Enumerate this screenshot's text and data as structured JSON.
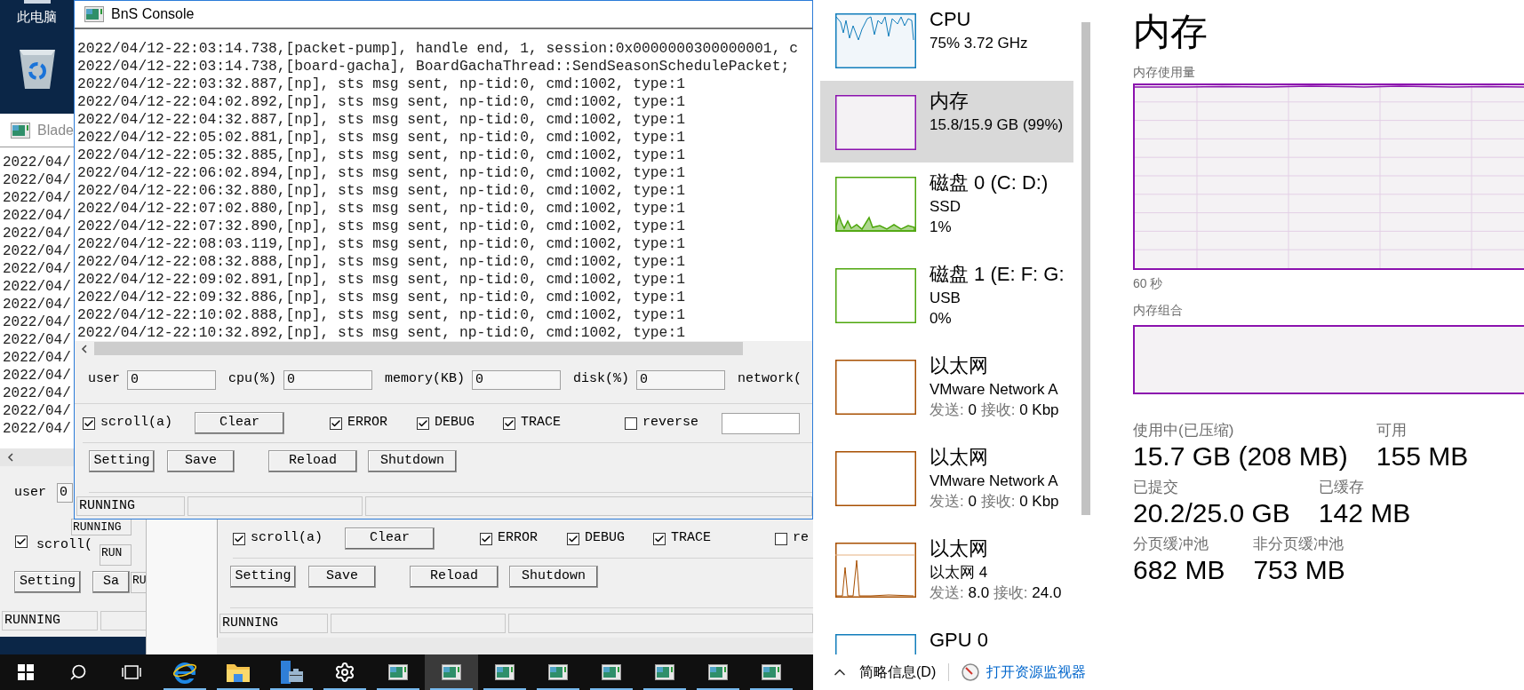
{
  "desktop_icons": [
    {
      "kind": "computer",
      "label": "此电脑"
    },
    {
      "kind": "recycle_bin"
    }
  ],
  "back_window": {
    "title": "Blade",
    "log_lines": [
      "2022/04/",
      "2022/04/",
      "2022/04/",
      "2022/04/",
      "2022/04/",
      "2022/04/",
      "2022/04/",
      "2022/04/",
      "2022/04/",
      "2022/04/",
      "2022/04/",
      "2022/04/",
      "2022/04/",
      "2022/04/",
      "2022/04/",
      "2022/04/"
    ],
    "field": {
      "label": "user",
      "value": "0"
    },
    "checkbox": {
      "label": "scroll(",
      "checked": true
    },
    "buttons": [
      "Setting",
      "Sa"
    ],
    "status": "RUNNING"
  },
  "stacked_status": [
    "RUNNING",
    "RUN",
    "RU"
  ],
  "console": {
    "title": "BnS Console",
    "log_lines": [
      "2022/04/12-22:03:14.738,[packet-pump], handle end, 1, session:0x0000000300000001, c",
      "2022/04/12-22:03:14.738,[board-gacha], BoardGachaThread::SendSeasonSchedulePacket;",
      "2022/04/12-22:03:32.887,[np], sts msg sent, np-tid:0, cmd:1002, type:1",
      "2022/04/12-22:04:02.892,[np], sts msg sent, np-tid:0, cmd:1002, type:1",
      "2022/04/12-22:04:32.887,[np], sts msg sent, np-tid:0, cmd:1002, type:1",
      "2022/04/12-22:05:02.881,[np], sts msg sent, np-tid:0, cmd:1002, type:1",
      "2022/04/12-22:05:32.885,[np], sts msg sent, np-tid:0, cmd:1002, type:1",
      "2022/04/12-22:06:02.894,[np], sts msg sent, np-tid:0, cmd:1002, type:1",
      "2022/04/12-22:06:32.880,[np], sts msg sent, np-tid:0, cmd:1002, type:1",
      "2022/04/12-22:07:02.880,[np], sts msg sent, np-tid:0, cmd:1002, type:1",
      "2022/04/12-22:07:32.890,[np], sts msg sent, np-tid:0, cmd:1002, type:1",
      "2022/04/12-22:08:03.119,[np], sts msg sent, np-tid:0, cmd:1002, type:1",
      "2022/04/12-22:08:32.888,[np], sts msg sent, np-tid:0, cmd:1002, type:1",
      "2022/04/12-22:09:02.891,[np], sts msg sent, np-tid:0, cmd:1002, type:1",
      "2022/04/12-22:09:32.886,[np], sts msg sent, np-tid:0, cmd:1002, type:1",
      "2022/04/12-22:10:02.888,[np], sts msg sent, np-tid:0, cmd:1002, type:1",
      "2022/04/12-22:10:32.892,[np], sts msg sent, np-tid:0, cmd:1002, type:1"
    ],
    "fields": [
      {
        "label": "user",
        "value": "0"
      },
      {
        "label": "cpu(%)",
        "value": "0"
      },
      {
        "label": "memory(KB)",
        "value": "0"
      },
      {
        "label": "disk(%)",
        "value": "0"
      },
      {
        "label": "network("
      }
    ],
    "toolbar": [
      {
        "kind": "checkbox",
        "label": "scroll(a)",
        "checked": true
      },
      {
        "kind": "button",
        "label": "Clear"
      },
      {
        "kind": "checkbox",
        "label": "ERROR",
        "checked": true
      },
      {
        "kind": "checkbox",
        "label": "DEBUG",
        "checked": true
      },
      {
        "kind": "checkbox",
        "label": "TRACE",
        "checked": true
      },
      {
        "kind": "checkbox",
        "label": "reverse",
        "checked": false
      },
      {
        "kind": "field"
      }
    ],
    "buttons": [
      "Setting",
      "Save",
      "Reload",
      "Shutdown"
    ],
    "status": "RUNNING"
  },
  "lower_console": {
    "toolbar": [
      {
        "kind": "checkbox",
        "label": "scroll(a)",
        "checked": true
      },
      {
        "kind": "button",
        "label": "Clear"
      },
      {
        "kind": "checkbox",
        "label": "ERROR",
        "checked": true
      },
      {
        "kind": "checkbox",
        "label": "DEBUG",
        "checked": true
      },
      {
        "kind": "checkbox",
        "label": "TRACE",
        "checked": true
      },
      {
        "kind": "checkbox",
        "label": "re",
        "checked": false
      }
    ],
    "buttons": [
      "Setting",
      "Save",
      "Reload",
      "Shutdown"
    ],
    "status": "RUNNING"
  },
  "taskbar": [
    {
      "kind": "start",
      "selected": false,
      "running": false
    },
    {
      "kind": "search",
      "selected": false,
      "running": false
    },
    {
      "kind": "task_view",
      "selected": false,
      "running": false
    },
    {
      "kind": "browser",
      "selected": false,
      "running": true
    },
    {
      "kind": "folder",
      "selected": false,
      "running": true
    },
    {
      "kind": "server_manager",
      "selected": false,
      "running": true
    },
    {
      "kind": "settings",
      "selected": false,
      "running": true
    },
    {
      "kind": "console",
      "selected": false,
      "running": true
    },
    {
      "kind": "console",
      "selected": true,
      "running": true
    },
    {
      "kind": "console",
      "selected": false,
      "running": true
    },
    {
      "kind": "console",
      "selected": false,
      "running": true
    },
    {
      "kind": "console",
      "selected": false,
      "running": true
    },
    {
      "kind": "console",
      "selected": false,
      "running": true
    },
    {
      "kind": "console",
      "selected": false,
      "running": true
    },
    {
      "kind": "console",
      "selected": false,
      "running": true
    }
  ],
  "task_manager": {
    "sidebar": [
      {
        "kind": "cpu",
        "title": "CPU",
        "selected": false,
        "active": true,
        "lines": [
          "75%  3.72 GHz"
        ]
      },
      {
        "kind": "memory",
        "title": "内存",
        "selected": true,
        "lines": [
          "15.8/15.9 GB (99%)"
        ]
      },
      {
        "kind": "disk",
        "title": "磁盘 0 (C: D:)",
        "selected": false,
        "active": true,
        "lines": [
          "SSD",
          "1%"
        ]
      },
      {
        "kind": "disk",
        "title": "磁盘 1 (E: F: G:",
        "selected": false,
        "active": false,
        "lines": [
          "USB",
          "0%"
        ]
      },
      {
        "kind": "ethernet",
        "title": "以太网",
        "selected": false,
        "active": false,
        "lines": [
          "VMware Network A"
        ],
        "traffic": {
          "sent_label": "发送:",
          "sent": "0",
          "recv_label": "接收:",
          "recv": "0 Kbp"
        }
      },
      {
        "kind": "ethernet",
        "title": "以太网",
        "selected": false,
        "active": false,
        "lines": [
          "VMware Network A"
        ],
        "traffic": {
          "sent_label": "发送:",
          "sent": "0",
          "recv_label": "接收:",
          "recv": "0 Kbp"
        }
      },
      {
        "kind": "ethernet",
        "title": "以太网",
        "selected": false,
        "active": true,
        "lines": [
          "以太网 4"
        ],
        "traffic": {
          "sent_label": "发送:",
          "sent": "8.0",
          "recv_label": "接收:",
          "recv": "24.0"
        }
      },
      {
        "kind": "gpu",
        "title": "GPU 0",
        "selected": false
      }
    ],
    "footer": {
      "toggle": "简略信息(D)",
      "link": "打开资源监视器"
    },
    "detail": {
      "title": "内存",
      "usage_label": "内存使用量",
      "time_label": "60 秒",
      "composition_label": "内存组合",
      "stats": [
        [
          {
            "label": "使用中(已压缩)",
            "value": "15.7 GB (208 MB)"
          },
          {
            "label": "可用",
            "value": "155 MB"
          }
        ],
        [
          {
            "label": "已提交",
            "value": "20.2/25.0 GB"
          },
          {
            "label": "已缓存",
            "value": "142 MB"
          }
        ],
        [
          {
            "label": "分页缓冲池",
            "value": "682 MB"
          },
          {
            "label": "非分页缓冲池",
            "value": "753 MB"
          }
        ]
      ]
    }
  }
}
